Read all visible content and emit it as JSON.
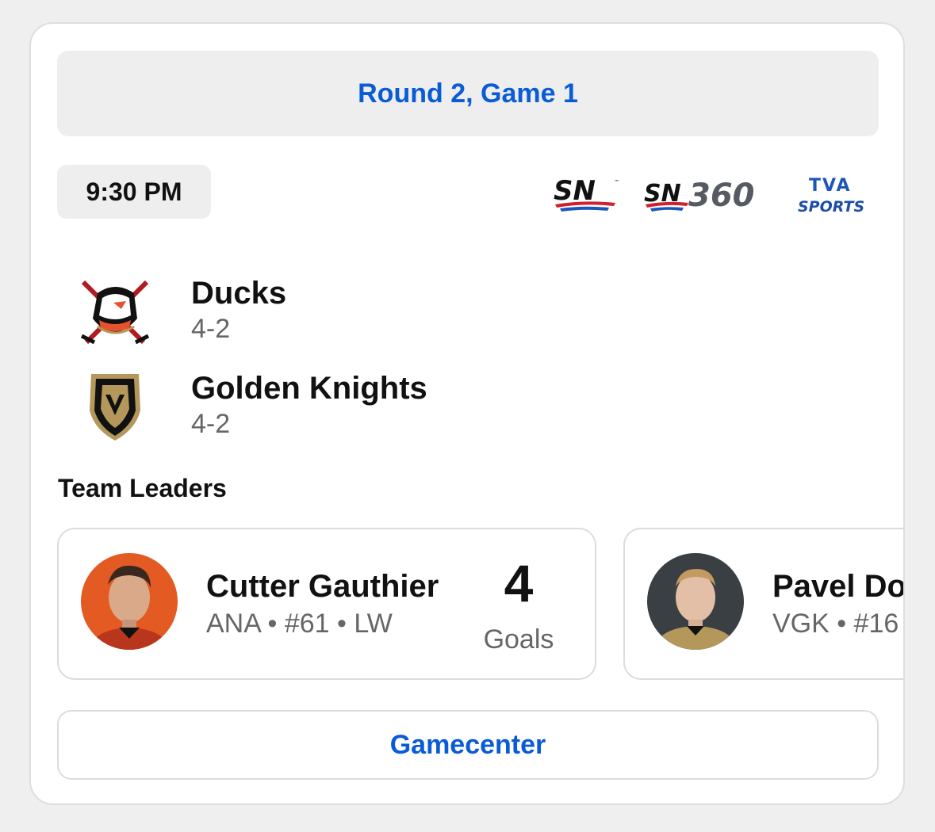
{
  "game": {
    "round_label": "Round 2, Game 1",
    "time": "9:30 PM"
  },
  "broadcasters": [
    {
      "icon": "sn-logo",
      "text": "SN"
    },
    {
      "icon": "sn360-logo",
      "text": "SN360"
    },
    {
      "icon": "tva-sports-logo",
      "text": "TVA SPORTS"
    }
  ],
  "teams": [
    {
      "name": "Ducks",
      "record": "4-2",
      "icon": "ducks-logo"
    },
    {
      "name": "Golden Knights",
      "record": "4-2",
      "icon": "golden-knights-logo"
    }
  ],
  "team_leaders": {
    "title": "Team Leaders",
    "cards": [
      {
        "name": "Cutter Gauthier",
        "meta": "ANA • #61 • LW",
        "stat_value": "4",
        "stat_label": "Goals",
        "avatar": "player-avatar"
      },
      {
        "name": "Pavel Do",
        "meta": "VGK • #16",
        "avatar": "player-avatar"
      }
    ]
  },
  "gamecenter_label": "Gamecenter",
  "colors": {
    "accent": "#0a5bd6",
    "ducks_orange": "#e8512b",
    "vgk_gold": "#b4975a"
  }
}
